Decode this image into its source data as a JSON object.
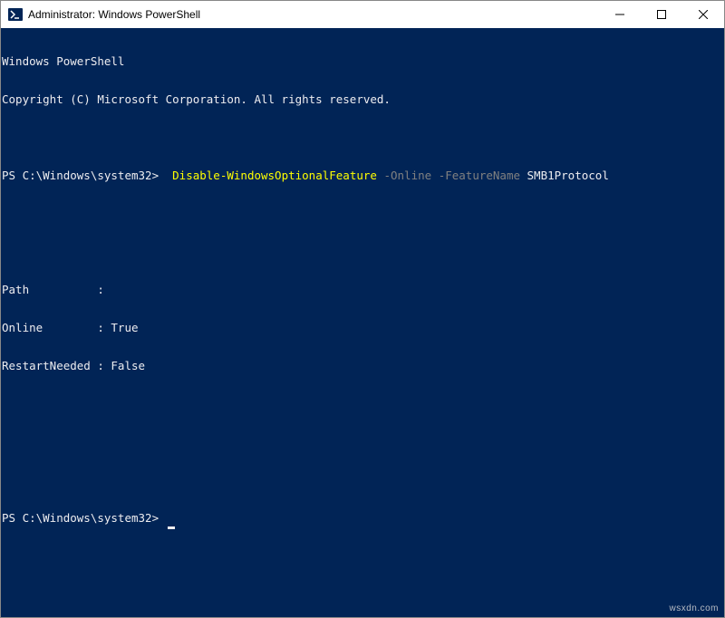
{
  "window": {
    "title": "Administrator: Windows PowerShell"
  },
  "terminal": {
    "header1": "Windows PowerShell",
    "header2": "Copyright (C) Microsoft Corporation. All rights reserved.",
    "prompt": "PS C:\\Windows\\system32>",
    "command": {
      "cmdlet": "Disable-WindowsOptionalFeature",
      "param1": "-Online",
      "param2": "-FeatureName",
      "arg": "SMB1Protocol"
    },
    "output": {
      "path_label": "Path          :",
      "online_label": "Online        : True",
      "restart_label": "RestartNeeded : False"
    }
  },
  "watermark": "wsxdn.com"
}
